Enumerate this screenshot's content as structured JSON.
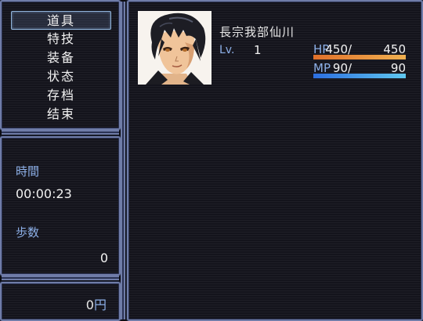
{
  "menu": {
    "items": [
      {
        "label": "道具"
      },
      {
        "label": "特技"
      },
      {
        "label": "装备"
      },
      {
        "label": "状态"
      },
      {
        "label": "存档"
      },
      {
        "label": "结束"
      }
    ],
    "selected_index": 0
  },
  "info": {
    "time_label": "時間",
    "time_value": "00:00:23",
    "steps_label": "歩数",
    "steps_value": "0"
  },
  "gold": {
    "amount": "0",
    "unit": "円"
  },
  "actor": {
    "name": "長宗我部仙川",
    "level_label": "Lv.",
    "level": "1",
    "hp_label": "HP",
    "hp_current": "450",
    "hp_max": "450",
    "hp_ratio": 1.0,
    "mp_label": "MP",
    "mp_current": "90",
    "mp_max": "90",
    "mp_ratio": 1.0,
    "separator": "/"
  },
  "colors": {
    "system_label": "#8db0e8",
    "hp_gauge": [
      "#e0702a",
      "#f0b050"
    ],
    "mp_gauge": [
      "#2c6ee0",
      "#60c8f0"
    ],
    "window_border": "#6f7ca8"
  }
}
